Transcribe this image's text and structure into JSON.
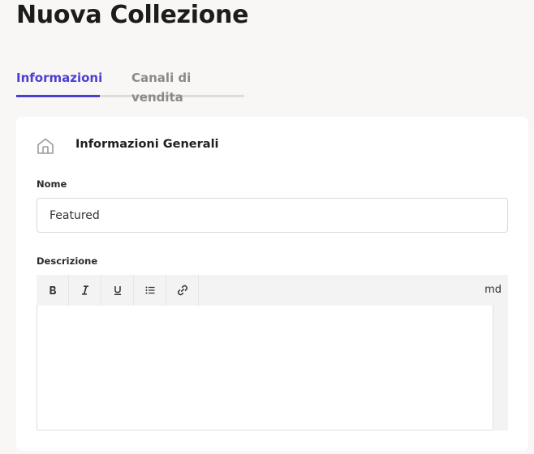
{
  "page": {
    "title": "Nuova Collezione"
  },
  "tabs": [
    {
      "label": "Informazioni",
      "active": true
    },
    {
      "label": "Canali di vendita",
      "active": false
    }
  ],
  "section": {
    "title": "Informazioni Generali",
    "icon": "home-icon"
  },
  "form": {
    "name_label": "Nome",
    "name_value": "Featured",
    "description_label": "Descrizione"
  },
  "editor": {
    "tools": [
      "bold-icon",
      "italic-icon",
      "underline-icon",
      "list-icon",
      "link-icon"
    ],
    "mode_label": "md"
  },
  "colors": {
    "accent": "#4b3fd1",
    "background": "#f8f7f5",
    "card": "#ffffff"
  }
}
